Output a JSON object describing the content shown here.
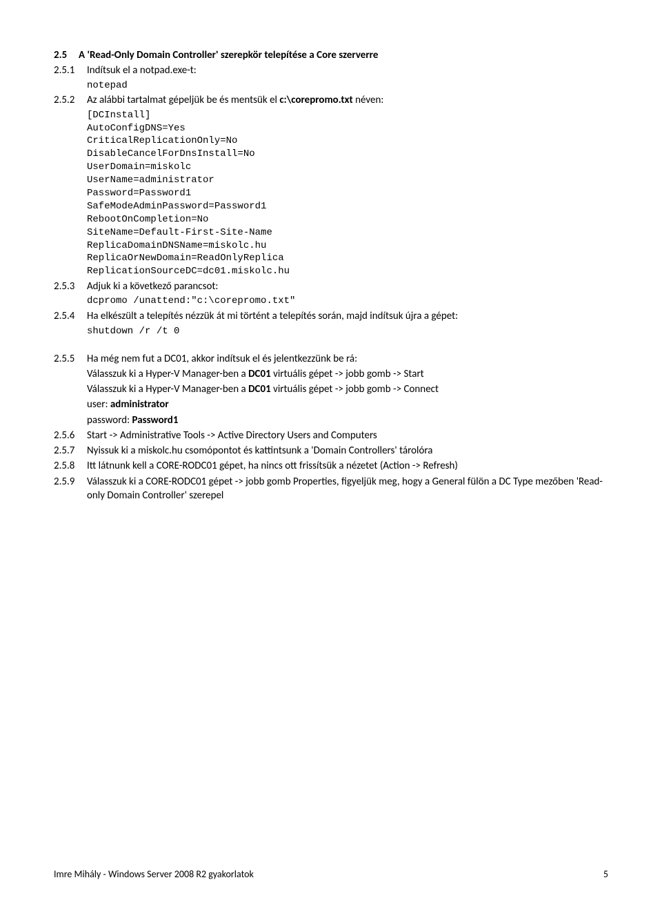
{
  "heading": {
    "num": "2.5",
    "text": "A 'Read-Only Domain Controller' szerepkör telepítése a Core szerverre"
  },
  "s251": {
    "num": "2.5.1",
    "text": "Indítsuk el a notpad.exe-t:",
    "code": "notepad"
  },
  "s252": {
    "num": "2.5.2",
    "prefix": "Az alábbi tartalmat gépeljük be és mentsük el ",
    "bold": "c:\\corepromo.txt",
    "suffix": " néven:",
    "code": "[DCInstall]\nAutoConfigDNS=Yes\nCriticalReplicationOnly=No\nDisableCancelForDnsInstall=No\nUserDomain=miskolc\nUserName=administrator\nPassword=Password1\nSafeModeAdminPassword=Password1\nRebootOnCompletion=No\nSiteName=Default-First-Site-Name\nReplicaDomainDNSName=miskolc.hu\nReplicaOrNewDomain=ReadOnlyReplica\nReplicationSourceDC=dc01.miskolc.hu"
  },
  "s253": {
    "num": "2.5.3",
    "text": "Adjuk ki a következő parancsot:",
    "code": "dcpromo /unattend:\"c:\\corepromo.txt\""
  },
  "s254": {
    "num": "2.5.4",
    "text": "Ha elkészült a telepítés nézzük át mi történt a telepítés során, majd indítsuk újra a gépet:",
    "code": "shutdown /r /t 0"
  },
  "s255": {
    "num": "2.5.5",
    "l1": "Ha még nem fut a DC01, akkor indítsuk el és jelentkezzünk be rá:",
    "l2a": "Válasszuk ki a Hyper-V Manager-ben a ",
    "l2b": "DC01",
    "l2c": " virtuális gépet -> jobb gomb -> Start",
    "l3a": "Válasszuk ki a Hyper-V Manager-ben a ",
    "l3b": "DC01",
    "l3c": " virtuális gépet -> jobb gomb -> Connect",
    "l4a": "user: ",
    "l4b": "administrator",
    "l5a": "password: ",
    "l5b": "Password1"
  },
  "s256": {
    "num": "2.5.6",
    "text": "Start -> Administrative Tools -> Active Directory Users and Computers"
  },
  "s257": {
    "num": "2.5.7",
    "text": "Nyissuk ki a miskolc.hu csomópontot és kattintsunk a 'Domain Controllers' tárolóra"
  },
  "s258": {
    "num": "2.5.8",
    "text": "Itt látnunk kell a CORE-RODC01 gépet, ha nincs ott frissítsük a nézetet (Action -> Refresh)"
  },
  "s259": {
    "num": "2.5.9",
    "text": "Válasszuk ki a CORE-RODC01 gépet -> jobb gomb Properties, figyeljük meg, hogy a General fülön a DC Type mezőben 'Read-only Domain Controller' szerepel"
  },
  "footer": {
    "left": "Imre Mihály - Windows Server 2008 R2 gyakorlatok",
    "right": "5"
  }
}
